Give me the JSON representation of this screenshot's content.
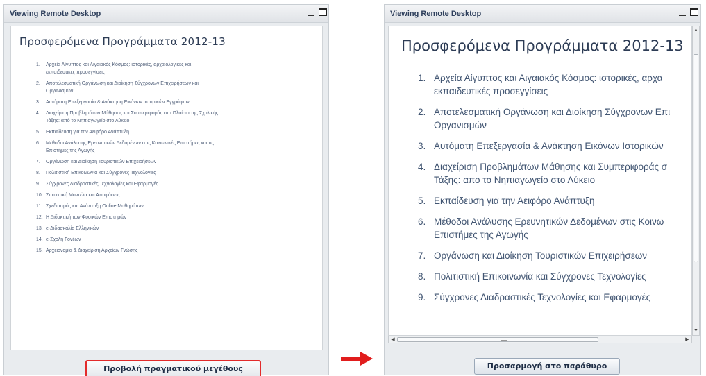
{
  "left_window": {
    "title": "Viewing Remote Desktop",
    "heading": "Προσφερόμενα Προγράμματα 2012-13",
    "items": [
      {
        "num": "1.",
        "text": "Αρχεία Αίγυπτος και Αιγαιακός Κόσμος: ιστορικές, αρχαιολογικές και",
        "text2": "εκπαιδευτικές προσεγγίσεις"
      },
      {
        "num": "2.",
        "text": "Αποτελεσματική Οργάνωση και Διοίκηση Σύγχρονων Επιχειρήσεων και",
        "text2": "Οργανισμών"
      },
      {
        "num": "3.",
        "text": "Αυτόματη Επεξεργασία & Ανάκτηση Εικόνων Ιστορικών Εγγράφων",
        "text2": ""
      },
      {
        "num": "4.",
        "text": "Διαχείριση Προβλημάτων Μάθησης και Συμπεριφοράς στα Πλαίσια της Σχολικής",
        "text2": "Τάξης: από το Νηπιαγωγείο στο Λύκειο"
      },
      {
        "num": "5.",
        "text": "Εκπαίδευση για την Αειφόρο Ανάπτυξη",
        "text2": ""
      },
      {
        "num": "6.",
        "text": "Μέθοδοι Ανάλυσης Ερευνητικών Δεδομένων στις Κοινωνικές Επιστήμες και τις",
        "text2": "Επιστήμες της Αγωγής"
      },
      {
        "num": "7.",
        "text": "Οργάνωση και Διοίκηση Τουριστικών Επιχειρήσεων",
        "text2": ""
      },
      {
        "num": "8.",
        "text": "Πολιτιστική Επικοινωνία και Σύγχρονες Τεχνολογίες",
        "text2": ""
      },
      {
        "num": "9.",
        "text": "Σύγχρονες Διαδραστικές Τεχνολογίες και Εφαρμογές",
        "text2": ""
      },
      {
        "num": "10.",
        "text": "Στατιστική Μοντέλα και Αποφάσεις",
        "text2": ""
      },
      {
        "num": "11.",
        "text": "Σχεδιασμός και Ανάπτυξη Online Μαθημάτων",
        "text2": ""
      },
      {
        "num": "12.",
        "text": "Η Διδακτική των Φυσικών Επιστημών",
        "text2": ""
      },
      {
        "num": "13.",
        "text": "e-Διδασκαλία Ελληνικών",
        "text2": ""
      },
      {
        "num": "14.",
        "text": "e-Σχολή Γονέων",
        "text2": ""
      },
      {
        "num": "15.",
        "text": "Αρχειονομία & Διαχείριση Αρχείων Γνώσης",
        "text2": ""
      }
    ],
    "button_label": "Προβολή πραγματικού μεγέθους"
  },
  "right_window": {
    "title": "Viewing Remote Desktop",
    "heading": "Προσφερόμενα Προγράμματα 2012-13",
    "items": [
      {
        "num": "1.",
        "text": "Αρχεία Αίγυπτος και Αιγαιακός Κόσμος: ιστορικές, αρχα",
        "text2": "εκπαιδευτικές προσεγγίσεις"
      },
      {
        "num": "2.",
        "text": "Αποτελεσματική Οργάνωση και Διοίκηση Σύγχρονων Επι",
        "text2": "Οργανισμών"
      },
      {
        "num": "3.",
        "text": "Αυτόματη Επεξεργασία & Ανάκτηση Εικόνων Ιστορικών",
        "text2": ""
      },
      {
        "num": "4.",
        "text": "Διαχείριση Προβλημάτων Μάθησης και Συμπεριφοράς σ",
        "text2": "Τάξης: απο το Νηπιαγωγείο στο Λύκειο"
      },
      {
        "num": "5.",
        "text": "Εκπαίδευση για την Αειφόρο Ανάπτυξη",
        "text2": ""
      },
      {
        "num": "6.",
        "text": "Μέθοδοι Ανάλυσης Ερευνητικών Δεδομένων στις Κοινω",
        "text2": "Επιστήμες της Αγωγής"
      },
      {
        "num": "7.",
        "text": "Οργάνωση και Διοίκηση Τουριστικών Επιχειρήσεων",
        "text2": ""
      },
      {
        "num": "8.",
        "text": "Πολιτιστική Επικοινωνία και Σύγχρονες Τεχνολογίες",
        "text2": ""
      },
      {
        "num": "9.",
        "text": "Σύγχρονες Διαδραστικές Τεχνολογίες και Εφαρμογές",
        "text2": ""
      }
    ],
    "button_label": "Προσαρμογή στο παράθυρο"
  },
  "icons": {
    "minimize": "minimize-icon",
    "maximize": "maximize-icon",
    "arrow": "right-arrow-icon"
  },
  "colors": {
    "highlight_border": "#e22b2b",
    "arrow": "#e11d1d",
    "heading": "#2d3c55",
    "title_text": "#2e3f5c"
  }
}
